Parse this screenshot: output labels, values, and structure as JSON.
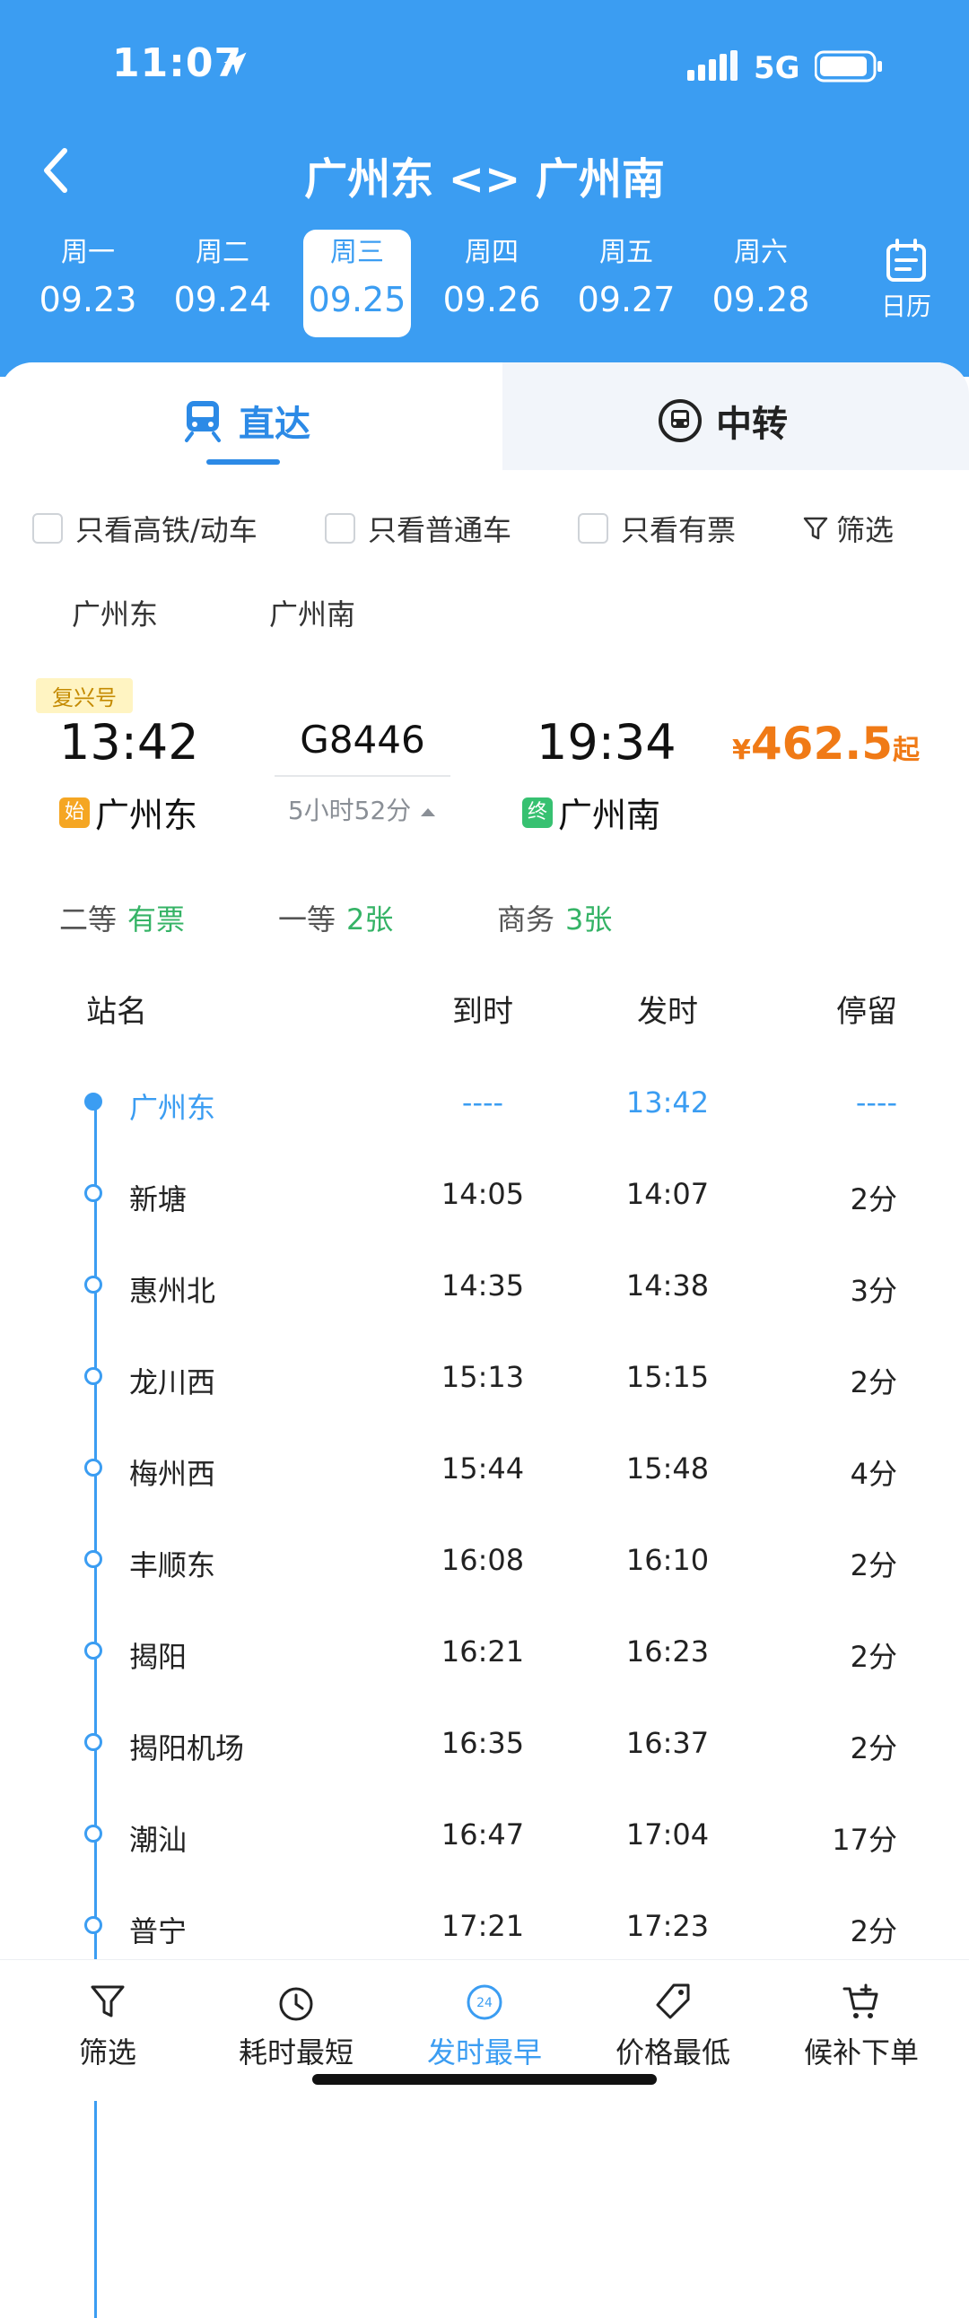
{
  "status_bar": {
    "time": "11:07",
    "network": "5G"
  },
  "header": {
    "title": "广州东 <> 广州南"
  },
  "dates": [
    {
      "weekday": "周一",
      "date": "09.23"
    },
    {
      "weekday": "周二",
      "date": "09.24"
    },
    {
      "weekday": "周三",
      "date": "09.25",
      "selected": true
    },
    {
      "weekday": "周四",
      "date": "09.26"
    },
    {
      "weekday": "周五",
      "date": "09.27"
    },
    {
      "weekday": "周六",
      "date": "09.28"
    }
  ],
  "calendar_label": "日历",
  "tabs": {
    "direct": "直达",
    "transfer": "中转"
  },
  "filters": {
    "high_speed": "只看高铁/动车",
    "normal": "只看普通车",
    "available": "只看有票",
    "filter": "筛选"
  },
  "station_filters": {
    "from": "广州东",
    "to": "广州南"
  },
  "train": {
    "badge": "复兴号",
    "number": "G8446",
    "depart_time": "13:42",
    "arrive_time": "19:34",
    "duration": "5小时52分",
    "from_station": "广州东",
    "to_station": "广州南",
    "start_tag": "始",
    "end_tag": "终",
    "price_symbol": "¥",
    "price": "462.5",
    "price_suffix": "起"
  },
  "seats": [
    {
      "class": "二等",
      "status": "有票"
    },
    {
      "class": "一等",
      "status": "2张"
    },
    {
      "class": "商务",
      "status": "3张"
    }
  ],
  "table": {
    "headers": [
      "站名",
      "到时",
      "发时",
      "停留"
    ],
    "rows": [
      {
        "station": "广州东",
        "arrive": "----",
        "depart": "13:42",
        "stay": "----"
      },
      {
        "station": "新塘",
        "arrive": "14:05",
        "depart": "14:07",
        "stay": "2分"
      },
      {
        "station": "惠州北",
        "arrive": "14:35",
        "depart": "14:38",
        "stay": "3分"
      },
      {
        "station": "龙川西",
        "arrive": "15:13",
        "depart": "15:15",
        "stay": "2分"
      },
      {
        "station": "梅州西",
        "arrive": "15:44",
        "depart": "15:48",
        "stay": "4分"
      },
      {
        "station": "丰顺东",
        "arrive": "16:08",
        "depart": "16:10",
        "stay": "2分"
      },
      {
        "station": "揭阳",
        "arrive": "16:21",
        "depart": "16:23",
        "stay": "2分"
      },
      {
        "station": "揭阳机场",
        "arrive": "16:35",
        "depart": "16:37",
        "stay": "2分"
      },
      {
        "station": "潮汕",
        "arrive": "16:47",
        "depart": "17:04",
        "stay": "17分"
      },
      {
        "station": "普宁",
        "arrive": "17:21",
        "depart": "17:23",
        "stay": "2分"
      }
    ]
  },
  "bottom_nav": {
    "filter": "筛选",
    "shortest": "耗时最短",
    "earliest": "发时最早",
    "earliest_icon_text": "24",
    "cheapest": "价格最低",
    "waitlist": "候补下单"
  },
  "colors": {
    "primary": "#3b9df2",
    "price": "#f07a16",
    "available": "#35b366",
    "start_tag": "#f5a623",
    "end_tag": "#37c171"
  }
}
